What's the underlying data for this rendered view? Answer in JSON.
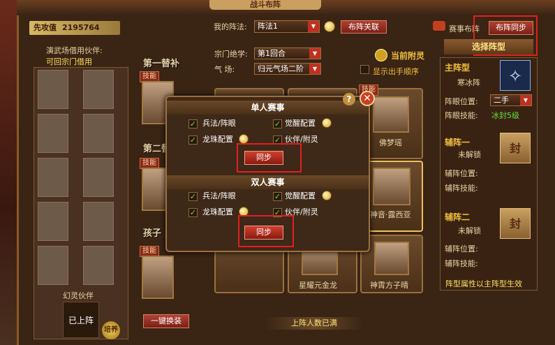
{
  "header": {
    "title": "战斗布阵"
  },
  "power": {
    "label": "先攻值",
    "value": "2195764"
  },
  "formation": {
    "label": "我的阵法:",
    "value": "阵法1",
    "link_button": "布阵关联",
    "sync_button": "布阵同步",
    "event_label": "赛事布阵",
    "choose_button": "选择阵型"
  },
  "skills": {
    "sect_label": "宗门绝学:",
    "sect_value": "第1回合",
    "qi_label": "气  场:",
    "qi_value": "归元气场二阶",
    "attach_label": "当前附灵",
    "show_order_label": "显示出手顺序"
  },
  "leftpanel": {
    "title": "演武场借用伙伴:",
    "link": "可回宗门借用",
    "phantom_title": "幻灵伙伴",
    "phantom_status": "已上阵",
    "cultivate": "培养"
  },
  "midcol": {
    "sub1": "第一替补",
    "sub2": "第二替补",
    "sub3": "孩子",
    "skill_tag": "技能",
    "swap_button": "一键换装"
  },
  "slots": {
    "names": [
      "佛梦瑶",
      "神音·露西亚",
      "星耀元金龙",
      "神霄方子晴"
    ],
    "skill_tag": "技能",
    "full_text": "上阵人数已满"
  },
  "popup": {
    "single_title": "单人赛事",
    "double_title": "双人赛事",
    "opt1": "兵法/阵眼",
    "opt2": "觉醒配置",
    "opt3": "龙珠配置",
    "opt4": "伙伴/附灵",
    "sync": "同步",
    "help": "?",
    "close": "✕"
  },
  "rightpanel": {
    "main_title": "主阵型",
    "main_name": "寒冰阵",
    "eye_pos_label": "阵眼位置:",
    "eye_pos_value": "二手",
    "eye_skill_label": "阵眼技能:",
    "eye_skill_value": "冰封5级",
    "aux1_title": "辅阵一",
    "aux2_title": "辅阵二",
    "locked": "未解锁",
    "aux_pos_label": "辅阵位置:",
    "aux_skill_label": "辅阵技能:",
    "seal": "封",
    "footer": "阵型属性以主阵型生效"
  },
  "colors": {
    "accent": "#e02020",
    "gold": "#f0c040",
    "green": "#60e040"
  }
}
